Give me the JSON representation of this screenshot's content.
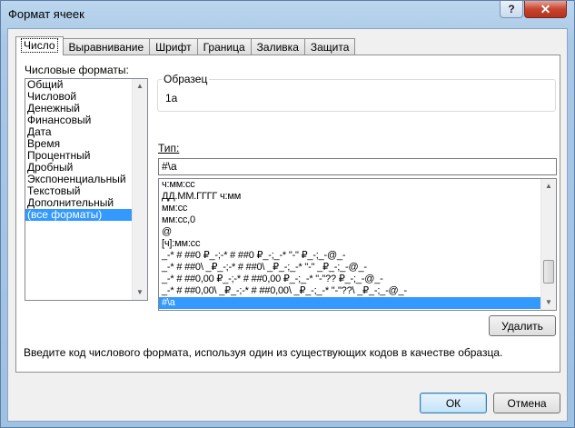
{
  "window": {
    "title": "Формат ячеек",
    "help": "?",
    "close": "✕"
  },
  "tabs": [
    "Число",
    "Выравнивание",
    "Шрифт",
    "Граница",
    "Заливка",
    "Защита"
  ],
  "number": {
    "formats_label": "Числовые форматы:",
    "formats": [
      "Общий",
      "Числовой",
      "Денежный",
      "Финансовый",
      "Дата",
      "Время",
      "Процентный",
      "Дробный",
      "Экспоненциальный",
      "Текстовый",
      "Дополнительный",
      "(все форматы)"
    ],
    "selected_format": "(все форматы)",
    "sample_label": "Образец",
    "sample_value": "1а",
    "type_label": "Тип:",
    "type_value": "#\\а",
    "type_list": [
      "ч:мм:сс",
      "ДД.ММ.ГГГГ ч:мм",
      "мм:сс",
      "мм:сс,0",
      "@",
      "[ч]:мм:сс",
      "_-* # ##0 ₽_-;-* # ##0 ₽_-;_-* \"-\" ₽_-;_-@_-",
      "_-* # ##0\\ _₽_-;-* # ##0\\ _₽_-;_-* \"-\" _₽_-;_-@_-",
      "_-* # ##0,00 ₽_-;-* # ##0,00 ₽_-;_-* \"-\"?? ₽_-;_-@_-",
      "_-* # ##0,00\\ _₽_-;-* # ##0,00\\ _₽_-;_-* \"-\"??\\ _₽_-;_-@_-",
      "#\\а"
    ],
    "selected_type": "#\\а",
    "delete_label": "Удалить",
    "hint": "Введите код числового формата, используя один из существующих кодов в качестве образца."
  },
  "footer": {
    "ok_label": "ОК",
    "cancel_label": "Отмена"
  },
  "scroll_position": 0.85
}
